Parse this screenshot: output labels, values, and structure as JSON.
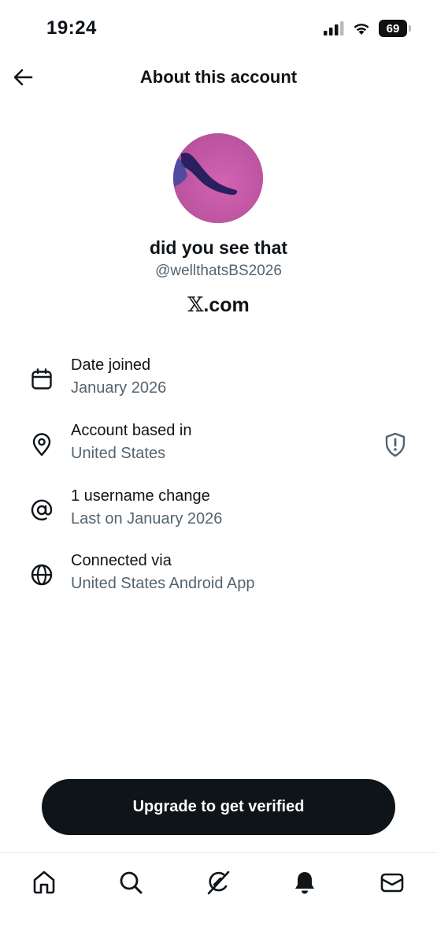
{
  "status_bar": {
    "time": "19:24",
    "battery": "69"
  },
  "header": {
    "title": "About this account",
    "back_icon": "arrow-left-icon"
  },
  "profile": {
    "display_name": "did you see that",
    "handle": "@wellthatsBS2026",
    "site_x": "𝕏",
    "site_suffix": ".com"
  },
  "info": [
    {
      "icon": "calendar-icon",
      "label": "Date joined",
      "value": "January 2026"
    },
    {
      "icon": "location-pin-icon",
      "label": "Account based in",
      "value": "United States"
    },
    {
      "icon": "at-sign-icon",
      "label": "1 username change",
      "value": "Last on January 2026"
    },
    {
      "icon": "globe-icon",
      "label": "Connected via",
      "value": "United States Android App"
    }
  ],
  "upgrade_button": "Upgrade to get verified",
  "tabs": [
    "home-icon",
    "search-icon",
    "grok-icon",
    "notifications-bell-icon",
    "messages-icon"
  ],
  "colors": {
    "text": "#0f1419",
    "secondary_text": "#536471",
    "avatar": "#c95aa8",
    "button": "#0f1419"
  }
}
